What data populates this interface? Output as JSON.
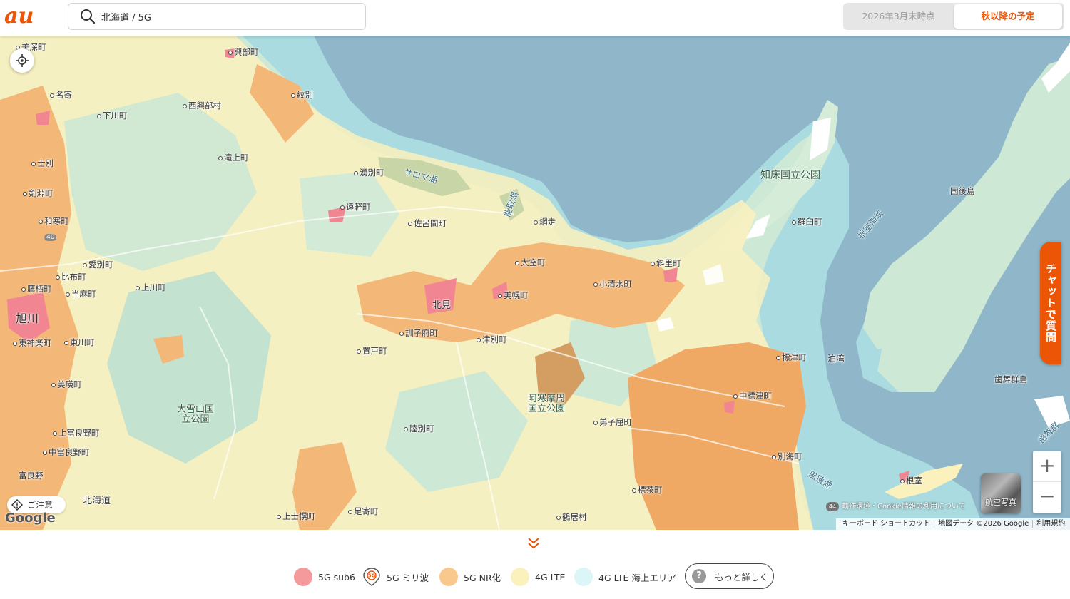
{
  "header": {
    "brand": "au",
    "search_value": "北海道 / 5G",
    "toggle_current": "2026年3月末時点",
    "toggle_future": "秋以降の予定"
  },
  "map": {
    "labels": {
      "misato": "美深町",
      "okoppe": "興部町",
      "nayoro": "名寄",
      "monbetsu": "紋別",
      "shimokawa": "下川町",
      "nishiokoppe": "西興部村",
      "shibetsu": "士別",
      "takinoue": "滝上町",
      "yubetsu": "湧別町",
      "saroma_lake": "サロマ湖",
      "kembuchi": "剣淵町",
      "engaru": "遠軽町",
      "notoro_lake": "能取湖",
      "wassamu": "和寒町",
      "saromabetsu": "佐呂間町",
      "abashiri": "網走",
      "shiretoko": "知床国立公園",
      "kunashiri": "国後島",
      "rausu": "羅臼町",
      "nemuro_strait": "根室海峡",
      "aibetsu": "愛別町",
      "pippu": "比布町",
      "ozora": "大空町",
      "shari": "斜里町",
      "takasu": "鷹栖町",
      "toma": "当麻町",
      "kamikawa": "上川町",
      "koshimizu": "小清水町",
      "asahikawa": "旭川",
      "kitami": "北見",
      "bihoro": "美幌町",
      "higashikagura": "東神楽町",
      "higashikawa": "東川町",
      "kunneppu": "訓子府町",
      "tsubetsu": "津別町",
      "oketo": "置戸町",
      "shibetsu_town": "標津町",
      "tomari_bay": "泊湾",
      "habomai": "歯舞群島",
      "biei": "美瑛町",
      "akan_park": "阿寒摩周国立公園",
      "nakashibetsu": "中標津町",
      "taisetsuzan": "大雪山国立公園",
      "teshikaga": "弟子屈町",
      "kamifurano": "上富良野町",
      "rikubetsu": "陸別町",
      "bekkai": "別海町",
      "nakafurano": "中富良野町",
      "furano": "富良野",
      "furen_lake": "風蓮湖",
      "nemuro": "根室",
      "hokkaido": "北海道",
      "shibecha": "標茶町",
      "kamishihoro": "上士幌町",
      "ashoro": "足寄町",
      "tsurui": "鶴居村",
      "habomai_strait": "歯舞群"
    },
    "road_40": "40",
    "road_44": "44",
    "chat_button": "チャットで質問",
    "zoom_in": "+",
    "zoom_out": "−",
    "aerial_label": "航空写真",
    "caution_label": "ご注意",
    "google_logo": "Google",
    "attribution_top": "動作環境・Cookie情報の利用について",
    "attribution_shortcuts": "キーボード ショートカット",
    "attribution_data": "地図データ ©2026 Google",
    "attribution_terms": "利用規約"
  },
  "legend": {
    "items": [
      {
        "label": "5G sub6",
        "color": "#f4999c"
      },
      {
        "label": "5G ミリ波",
        "color": "#eb5505"
      },
      {
        "label": "5G NR化",
        "color": "#f8c88d"
      },
      {
        "label": "4G LTE",
        "color": "#fbf1bd"
      },
      {
        "label": "4G LTE 海上エリア",
        "color": "#dcf5f7"
      }
    ],
    "more_label": "もっと詳しく",
    "more_icon": "?"
  },
  "colors": {
    "accent": "#eb5505",
    "sea": "#a9dbe0",
    "ocean": "#8fb7c9"
  }
}
